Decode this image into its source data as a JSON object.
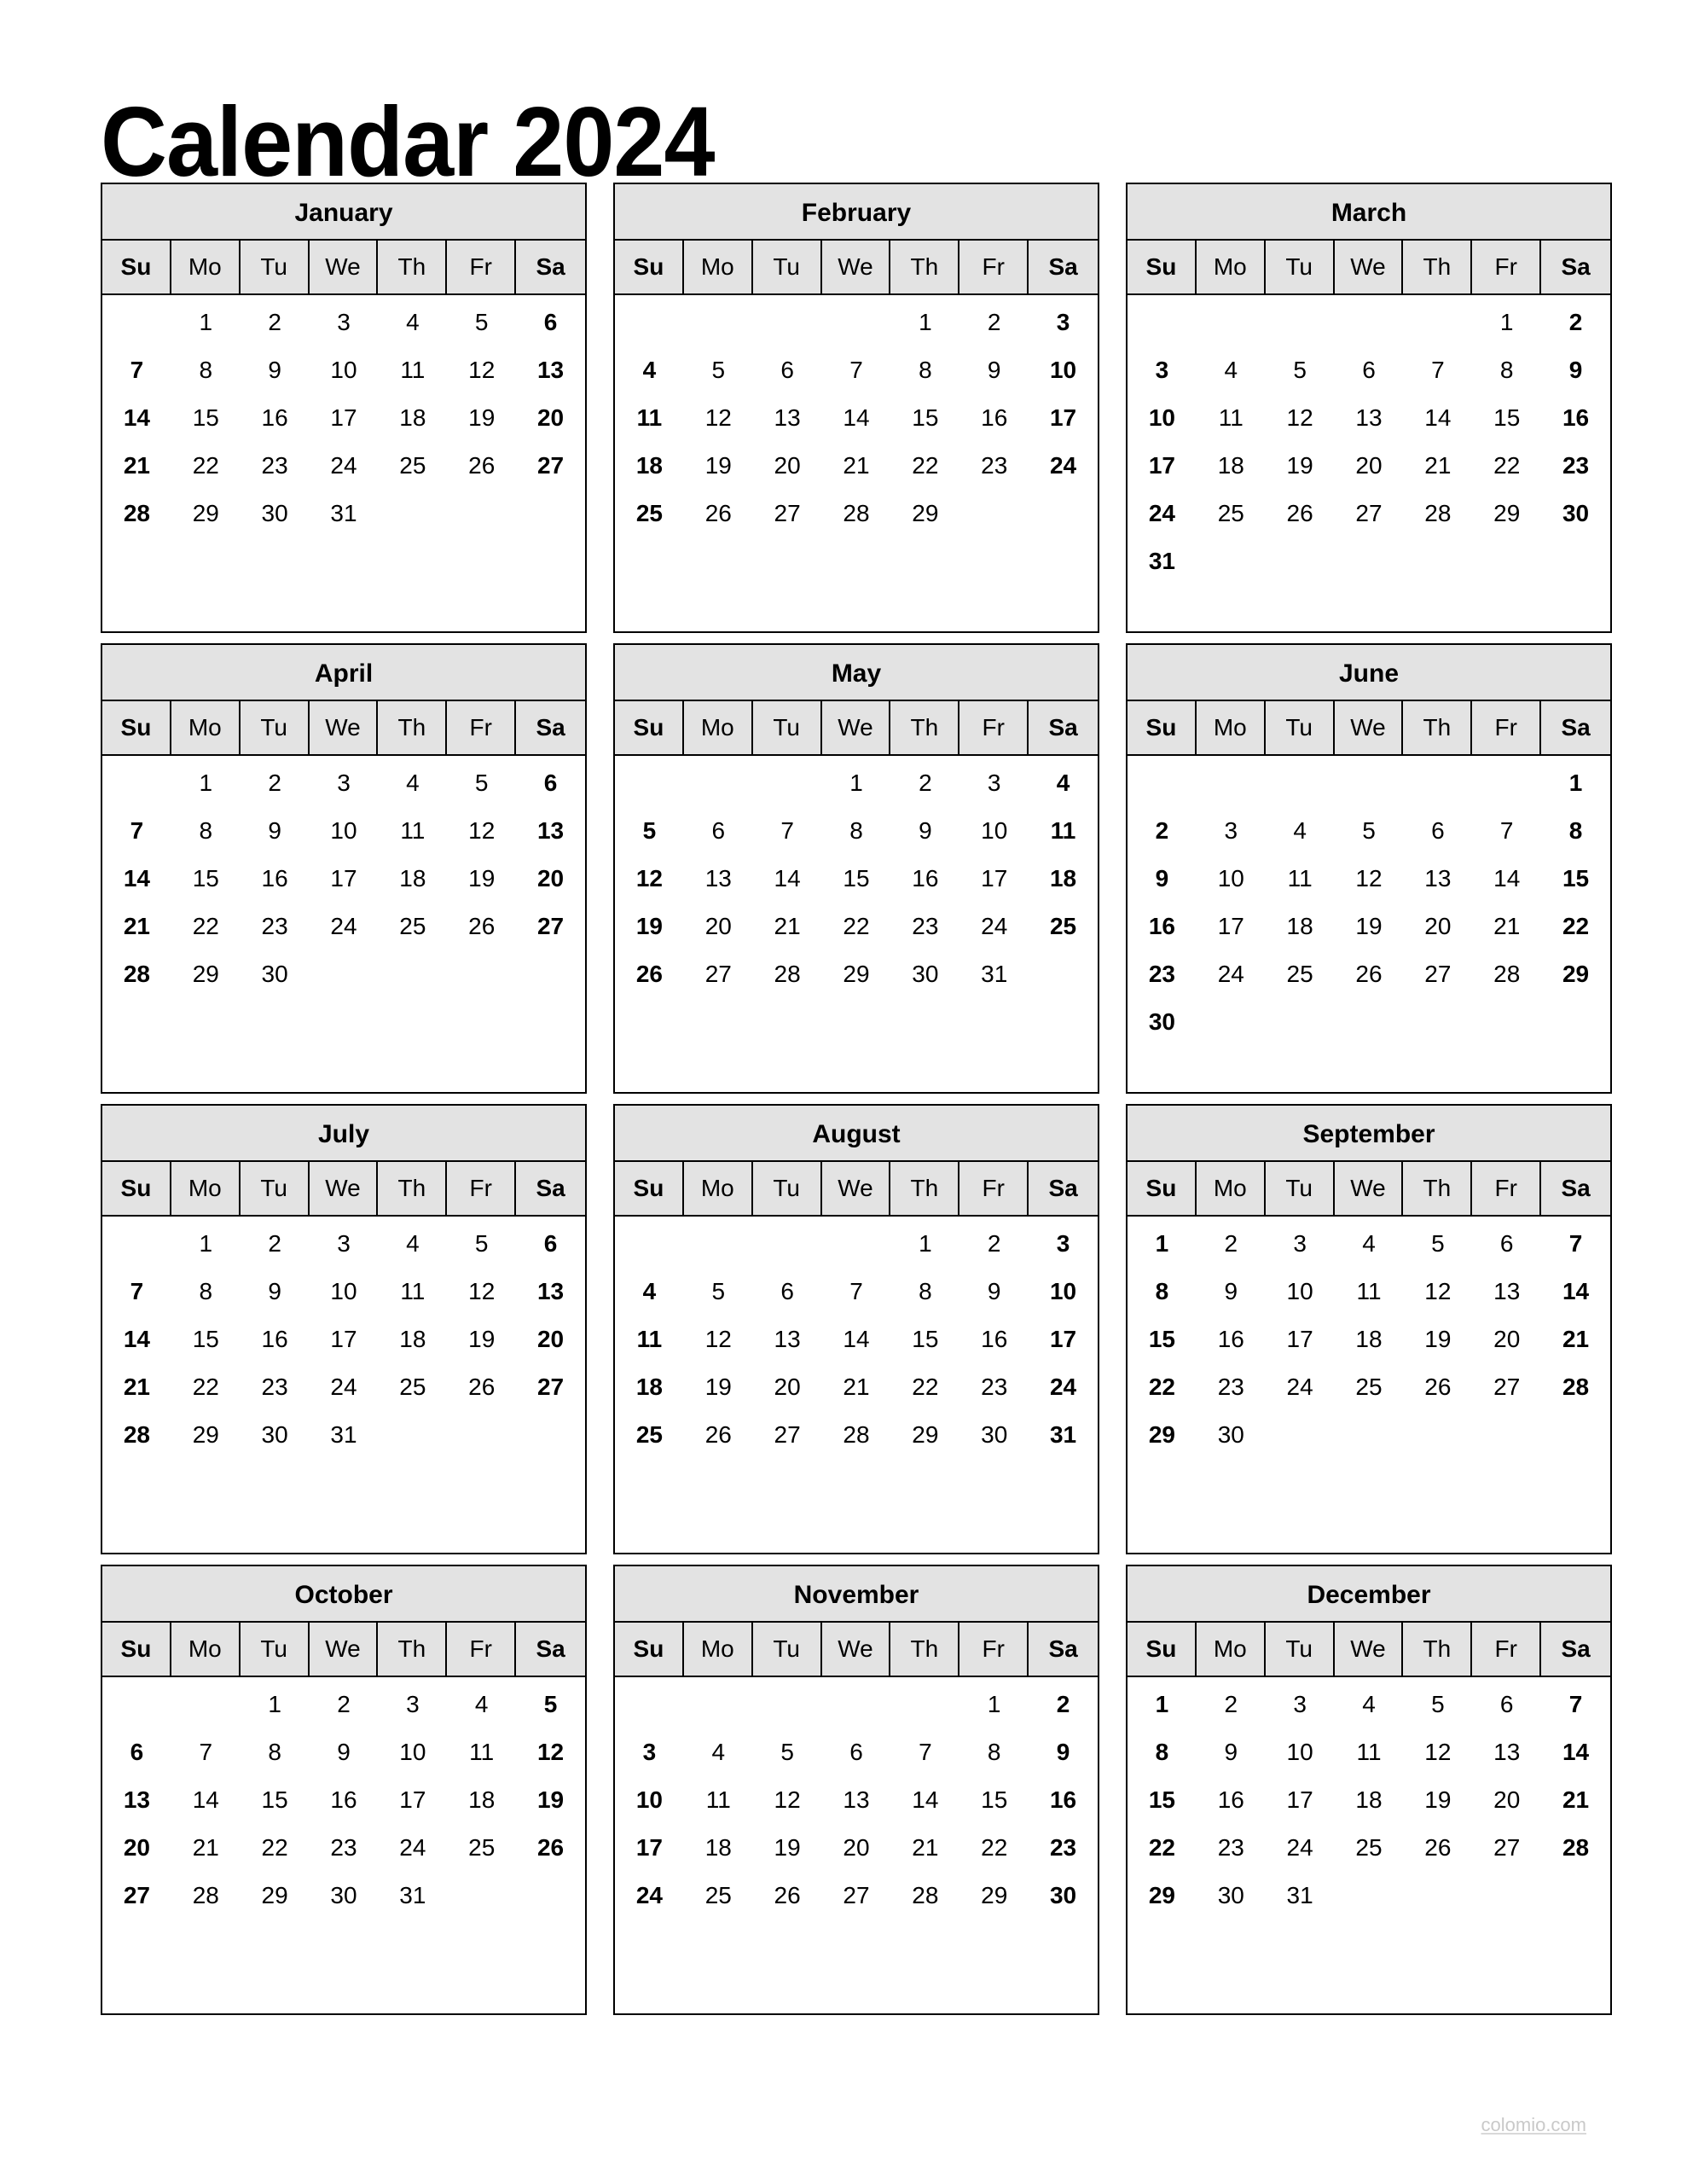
{
  "document": {
    "title": "Calendar 2024",
    "year": "2024",
    "watermark": "colomio.com",
    "colors": {
      "header_background": "#e3e3e3",
      "border": "#000000",
      "page_background": "#ffffff",
      "text": "#000000",
      "watermark_text": "#c9c9c9"
    }
  },
  "weekday_headers": [
    {
      "label": "Su",
      "weekend": true
    },
    {
      "label": "Mo",
      "weekend": false
    },
    {
      "label": "Tu",
      "weekend": false
    },
    {
      "label": "We",
      "weekend": false
    },
    {
      "label": "Th",
      "weekend": false
    },
    {
      "label": "Fr",
      "weekend": false
    },
    {
      "label": "Sa",
      "weekend": true
    }
  ],
  "months": [
    {
      "name": "January",
      "days_in_month": 31,
      "first_weekday_index": 1,
      "weeks": [
        [
          "",
          "1",
          "2",
          "3",
          "4",
          "5",
          "6"
        ],
        [
          "7",
          "8",
          "9",
          "10",
          "11",
          "12",
          "13"
        ],
        [
          "14",
          "15",
          "16",
          "17",
          "18",
          "19",
          "20"
        ],
        [
          "21",
          "22",
          "23",
          "24",
          "25",
          "26",
          "27"
        ],
        [
          "28",
          "29",
          "30",
          "31",
          "",
          "",
          ""
        ]
      ]
    },
    {
      "name": "February",
      "days_in_month": 29,
      "first_weekday_index": 4,
      "weeks": [
        [
          "",
          "",
          "",
          "",
          "1",
          "2",
          "3"
        ],
        [
          "4",
          "5",
          "6",
          "7",
          "8",
          "9",
          "10"
        ],
        [
          "11",
          "12",
          "13",
          "14",
          "15",
          "16",
          "17"
        ],
        [
          "18",
          "19",
          "20",
          "21",
          "22",
          "23",
          "24"
        ],
        [
          "25",
          "26",
          "27",
          "28",
          "29",
          "",
          ""
        ]
      ]
    },
    {
      "name": "March",
      "days_in_month": 31,
      "first_weekday_index": 5,
      "weeks": [
        [
          "",
          "",
          "",
          "",
          "",
          "1",
          "2"
        ],
        [
          "3",
          "4",
          "5",
          "6",
          "7",
          "8",
          "9"
        ],
        [
          "10",
          "11",
          "12",
          "13",
          "14",
          "15",
          "16"
        ],
        [
          "17",
          "18",
          "19",
          "20",
          "21",
          "22",
          "23"
        ],
        [
          "24",
          "25",
          "26",
          "27",
          "28",
          "29",
          "30"
        ],
        [
          "31",
          "",
          "",
          "",
          "",
          "",
          ""
        ]
      ]
    },
    {
      "name": "April",
      "days_in_month": 30,
      "first_weekday_index": 1,
      "weeks": [
        [
          "",
          "1",
          "2",
          "3",
          "4",
          "5",
          "6"
        ],
        [
          "7",
          "8",
          "9",
          "10",
          "11",
          "12",
          "13"
        ],
        [
          "14",
          "15",
          "16",
          "17",
          "18",
          "19",
          "20"
        ],
        [
          "21",
          "22",
          "23",
          "24",
          "25",
          "26",
          "27"
        ],
        [
          "28",
          "29",
          "30",
          "",
          "",
          "",
          ""
        ]
      ]
    },
    {
      "name": "May",
      "days_in_month": 31,
      "first_weekday_index": 3,
      "weeks": [
        [
          "",
          "",
          "",
          "1",
          "2",
          "3",
          "4"
        ],
        [
          "5",
          "6",
          "7",
          "8",
          "9",
          "10",
          "11"
        ],
        [
          "12",
          "13",
          "14",
          "15",
          "16",
          "17",
          "18"
        ],
        [
          "19",
          "20",
          "21",
          "22",
          "23",
          "24",
          "25"
        ],
        [
          "26",
          "27",
          "28",
          "29",
          "30",
          "31",
          ""
        ]
      ]
    },
    {
      "name": "June",
      "days_in_month": 30,
      "first_weekday_index": 6,
      "weeks": [
        [
          "",
          "",
          "",
          "",
          "",
          "",
          "1"
        ],
        [
          "2",
          "3",
          "4",
          "5",
          "6",
          "7",
          "8"
        ],
        [
          "9",
          "10",
          "11",
          "12",
          "13",
          "14",
          "15"
        ],
        [
          "16",
          "17",
          "18",
          "19",
          "20",
          "21",
          "22"
        ],
        [
          "23",
          "24",
          "25",
          "26",
          "27",
          "28",
          "29"
        ],
        [
          "30",
          "",
          "",
          "",
          "",
          "",
          ""
        ]
      ]
    },
    {
      "name": "July",
      "days_in_month": 31,
      "first_weekday_index": 1,
      "weeks": [
        [
          "",
          "1",
          "2",
          "3",
          "4",
          "5",
          "6"
        ],
        [
          "7",
          "8",
          "9",
          "10",
          "11",
          "12",
          "13"
        ],
        [
          "14",
          "15",
          "16",
          "17",
          "18",
          "19",
          "20"
        ],
        [
          "21",
          "22",
          "23",
          "24",
          "25",
          "26",
          "27"
        ],
        [
          "28",
          "29",
          "30",
          "31",
          "",
          "",
          ""
        ]
      ]
    },
    {
      "name": "August",
      "days_in_month": 31,
      "first_weekday_index": 4,
      "weeks": [
        [
          "",
          "",
          "",
          "",
          "1",
          "2",
          "3"
        ],
        [
          "4",
          "5",
          "6",
          "7",
          "8",
          "9",
          "10"
        ],
        [
          "11",
          "12",
          "13",
          "14",
          "15",
          "16",
          "17"
        ],
        [
          "18",
          "19",
          "20",
          "21",
          "22",
          "23",
          "24"
        ],
        [
          "25",
          "26",
          "27",
          "28",
          "29",
          "30",
          "31"
        ]
      ]
    },
    {
      "name": "September",
      "days_in_month": 30,
      "first_weekday_index": 0,
      "weeks": [
        [
          "1",
          "2",
          "3",
          "4",
          "5",
          "6",
          "7"
        ],
        [
          "8",
          "9",
          "10",
          "11",
          "12",
          "13",
          "14"
        ],
        [
          "15",
          "16",
          "17",
          "18",
          "19",
          "20",
          "21"
        ],
        [
          "22",
          "23",
          "24",
          "25",
          "26",
          "27",
          "28"
        ],
        [
          "29",
          "30",
          "",
          "",
          "",
          "",
          ""
        ]
      ]
    },
    {
      "name": "October",
      "days_in_month": 31,
      "first_weekday_index": 2,
      "weeks": [
        [
          "",
          "",
          "1",
          "2",
          "3",
          "4",
          "5"
        ],
        [
          "6",
          "7",
          "8",
          "9",
          "10",
          "11",
          "12"
        ],
        [
          "13",
          "14",
          "15",
          "16",
          "17",
          "18",
          "19"
        ],
        [
          "20",
          "21",
          "22",
          "23",
          "24",
          "25",
          "26"
        ],
        [
          "27",
          "28",
          "29",
          "30",
          "31",
          "",
          ""
        ]
      ]
    },
    {
      "name": "November",
      "days_in_month": 30,
      "first_weekday_index": 5,
      "weeks": [
        [
          "",
          "",
          "",
          "",
          "",
          "1",
          "2"
        ],
        [
          "3",
          "4",
          "5",
          "6",
          "7",
          "8",
          "9"
        ],
        [
          "10",
          "11",
          "12",
          "13",
          "14",
          "15",
          "16"
        ],
        [
          "17",
          "18",
          "19",
          "20",
          "21",
          "22",
          "23"
        ],
        [
          "24",
          "25",
          "26",
          "27",
          "28",
          "29",
          "30"
        ]
      ]
    },
    {
      "name": "December",
      "days_in_month": 31,
      "first_weekday_index": 0,
      "weeks": [
        [
          "1",
          "2",
          "3",
          "4",
          "5",
          "6",
          "7"
        ],
        [
          "8",
          "9",
          "10",
          "11",
          "12",
          "13",
          "14"
        ],
        [
          "15",
          "16",
          "17",
          "18",
          "19",
          "20",
          "21"
        ],
        [
          "22",
          "23",
          "24",
          "25",
          "26",
          "27",
          "28"
        ],
        [
          "29",
          "30",
          "31",
          "",
          "",
          "",
          ""
        ]
      ]
    }
  ]
}
